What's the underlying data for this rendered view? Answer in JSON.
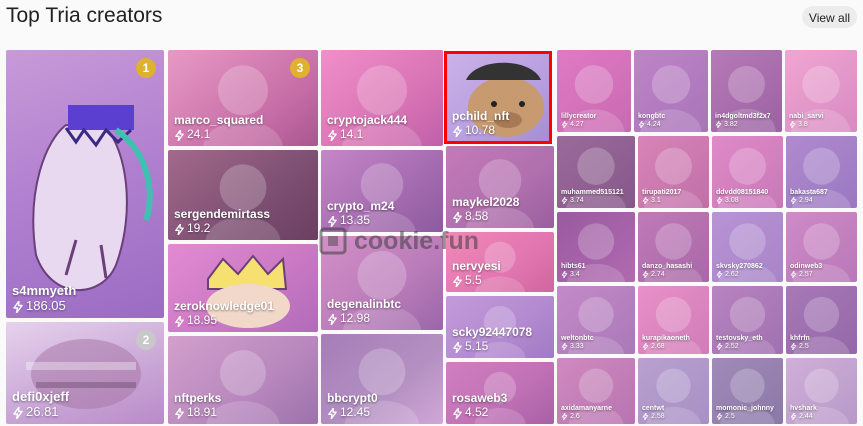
{
  "header": {
    "title": "Top Tria creators",
    "view_all_label": "View all"
  },
  "watermark": "cookie.fun",
  "colors": {
    "highlight": "#ff0000",
    "gold_badge": "#e0b030",
    "silver_badge": "#c8c8c8"
  },
  "creators": [
    {
      "name": "s4mmyeth",
      "score": "186.05",
      "rank": "1"
    },
    {
      "name": "defi0xjeff",
      "score": "26.81",
      "rank": "2"
    },
    {
      "name": "marco_squared",
      "score": "24.1",
      "rank": "3"
    },
    {
      "name": "sergendemirtass",
      "score": "19.2"
    },
    {
      "name": "zeroknowledge01",
      "score": "18.95"
    },
    {
      "name": "nftperks",
      "score": "18.91"
    },
    {
      "name": "cryptojack444",
      "score": "14.1"
    },
    {
      "name": "crypto_m24",
      "score": "13.35"
    },
    {
      "name": "degenalinbtc",
      "score": "12.98"
    },
    {
      "name": "bbcrypt0",
      "score": "12.45"
    },
    {
      "name": "pchild_nft",
      "score": "10.78"
    },
    {
      "name": "maykel2028",
      "score": "8.58"
    },
    {
      "name": "nervyesi",
      "score": "5.5"
    },
    {
      "name": "scky92447078",
      "score": "5.15"
    },
    {
      "name": "rosaweb3",
      "score": "4.52"
    },
    {
      "name": "lillycreator",
      "score": "4.27"
    },
    {
      "name": "kongbtc",
      "score": "4.24"
    },
    {
      "name": "in4dgoltmd3f2x7",
      "score": "3.82"
    },
    {
      "name": "nabi_sarvi",
      "score": "3.8"
    },
    {
      "name": "muhammed515121",
      "score": "3.74"
    },
    {
      "name": "tirupati2017",
      "score": "3.1"
    },
    {
      "name": "ddvdd08151840",
      "score": "3.08"
    },
    {
      "name": "bakasta687",
      "score": "2.94"
    },
    {
      "name": "hibts61",
      "score": "3.4"
    },
    {
      "name": "danzo_hasashi",
      "score": "2.74"
    },
    {
      "name": "skvsky270862",
      "score": "2.62"
    },
    {
      "name": "odinweb3",
      "score": "2.57"
    },
    {
      "name": "weltonbtc",
      "score": "3.33"
    },
    {
      "name": "kurapikaoneth",
      "score": "2.68"
    },
    {
      "name": "testovsky_eth",
      "score": "2.52"
    },
    {
      "name": "khfrfn",
      "score": "2.5"
    },
    {
      "name": "axidamanyarne",
      "score": "2.6"
    },
    {
      "name": "centwt",
      "score": "2.58"
    },
    {
      "name": "momonic_johnny",
      "score": "2.5"
    },
    {
      "name": "hvshark",
      "score": "2.44"
    }
  ]
}
